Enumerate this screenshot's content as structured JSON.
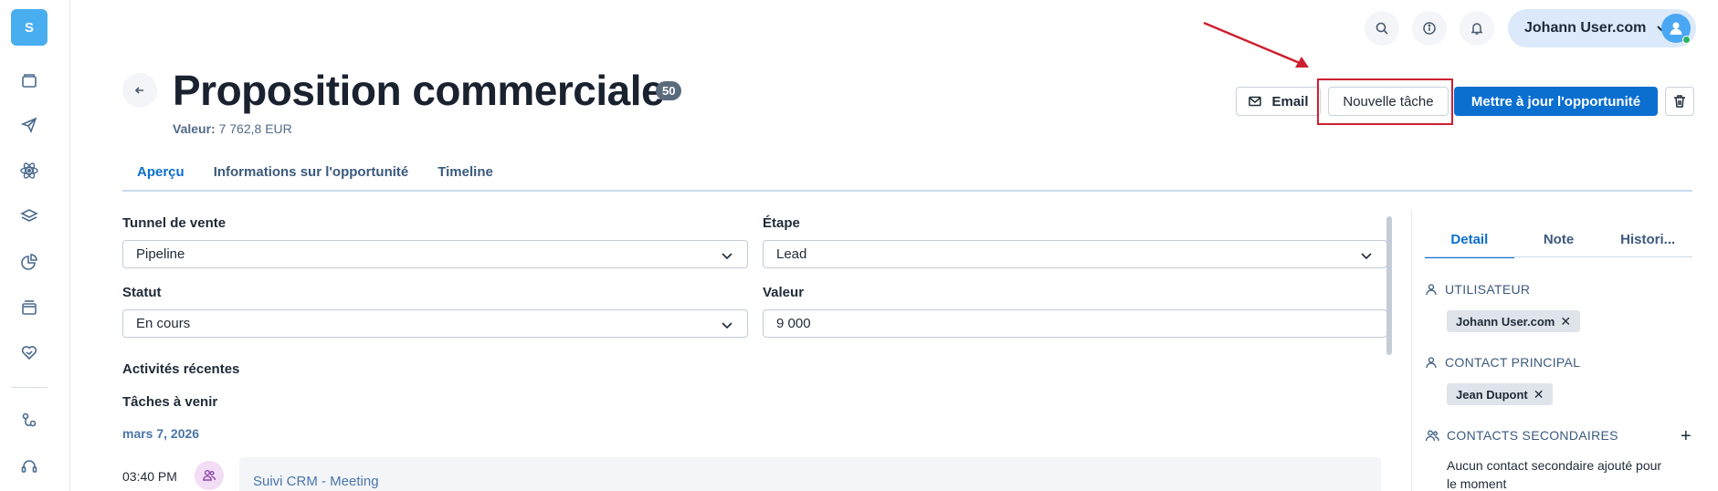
{
  "rail": {
    "logo_letter": "S",
    "items": [
      {
        "icon": "folder-icon"
      },
      {
        "icon": "paper-plane-icon"
      },
      {
        "icon": "atom-icon"
      },
      {
        "icon": "layers-icon"
      },
      {
        "icon": "pie-chart-icon"
      },
      {
        "icon": "cards-icon"
      },
      {
        "icon": "heart-handshake-icon"
      },
      {
        "icon": "workflow-icon"
      },
      {
        "icon": "support-headset-icon"
      }
    ]
  },
  "topbar": {
    "user_name": "Johann User.com",
    "icons": [
      "search-icon",
      "info-icon",
      "bell-icon"
    ]
  },
  "header": {
    "title": "Proposition commerciale",
    "badge": "50",
    "value_label": "Valeur:",
    "value_amount": "7 762,8 EUR",
    "buttons": {
      "email": "Email",
      "new_task": "Nouvelle tâche",
      "update": "Mettre à jour l'opportunité"
    }
  },
  "tabs": [
    "Aperçu",
    "Informations sur l'opportunité",
    "Timeline"
  ],
  "form": {
    "pipeline_label": "Tunnel de vente",
    "pipeline_value": "Pipeline",
    "stage_label": "Étape",
    "stage_value": "Lead",
    "status_label": "Statut",
    "status_value": "En cours",
    "value_label": "Valeur",
    "value_value": "9 000"
  },
  "activities": {
    "recent_title": "Activités récentes",
    "upcoming_title": "Tâches à venir",
    "date": "mars 7, 2026",
    "time": "03:40 PM",
    "task_title": "Suivi CRM - Meeting"
  },
  "side_panel": {
    "tabs": [
      "Detail",
      "Note",
      "Histori..."
    ],
    "user_heading": "UTILISATEUR",
    "user_chip": "Johann User.com",
    "contact_heading": "CONTACT PRINCIPAL",
    "contact_chip": "Jean Dupont",
    "secondary_heading": "CONTACTS SECONDAIRES",
    "add_symbol": "+",
    "secondary_empty": "Aucun contact secondaire ajouté pour le moment",
    "chip_remove": "✕"
  },
  "colors": {
    "accent": "#0b6fd0",
    "highlight": "#cc2030",
    "logo": "#48aef0"
  }
}
